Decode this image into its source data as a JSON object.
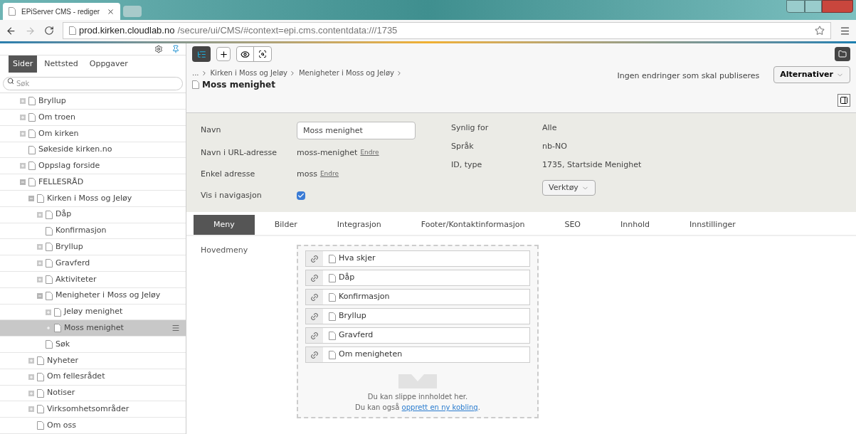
{
  "browser": {
    "tab_title": "EPiServer CMS - rediger",
    "url_host": "prod.kirken.cloudlab.no",
    "url_path": "/secure/ui/CMS/#context=epi.cms.contentdata:///1735"
  },
  "sidebar": {
    "tabs": [
      {
        "label": "Sider",
        "selected": true
      },
      {
        "label": "Nettsted",
        "selected": false
      },
      {
        "label": "Oppgaver",
        "selected": false
      }
    ],
    "search": {
      "placeholder": "Søk"
    },
    "tree": [
      {
        "label": "Bryllup",
        "expandable": true,
        "expanded": false,
        "selected": false
      },
      {
        "label": "Om troen",
        "expandable": true,
        "expanded": false,
        "selected": false
      },
      {
        "label": "Om kirken",
        "expandable": true,
        "expanded": false,
        "selected": false
      },
      {
        "label": "Søkeside kirken.no",
        "expandable": false,
        "expanded": false,
        "selected": false
      },
      {
        "label": "Oppslag forside",
        "expandable": true,
        "expanded": false,
        "selected": false
      },
      {
        "label": "FELLESRÅD",
        "expandable": true,
        "expanded": true,
        "selected": false,
        "children": [
          {
            "label": "Kirken i Moss og Jeløy",
            "expandable": true,
            "expanded": true,
            "selected": false,
            "children": [
              {
                "label": "Dåp",
                "expandable": true,
                "expanded": false,
                "selected": false
              },
              {
                "label": "Konfirmasjon",
                "expandable": false,
                "expanded": false,
                "selected": false
              },
              {
                "label": "Bryllup",
                "expandable": true,
                "expanded": false,
                "selected": false
              },
              {
                "label": "Gravferd",
                "expandable": true,
                "expanded": false,
                "selected": false
              },
              {
                "label": "Aktiviteter",
                "expandable": true,
                "expanded": false,
                "selected": false
              },
              {
                "label": "Menigheter i Moss og Jeløy",
                "expandable": true,
                "expanded": true,
                "selected": false,
                "children": [
                  {
                    "label": "Jeløy menighet",
                    "expandable": true,
                    "expanded": false,
                    "selected": false
                  },
                  {
                    "label": "Moss menighet",
                    "expandable": true,
                    "expanded": false,
                    "selected": true
                  }
                ]
              },
              {
                "label": "Søk",
                "expandable": false,
                "expanded": false,
                "selected": false
              }
            ]
          },
          {
            "label": "Nyheter",
            "expandable": true,
            "expanded": false,
            "selected": false
          },
          {
            "label": "Om fellesrådet",
            "expandable": true,
            "expanded": false,
            "selected": false
          },
          {
            "label": "Notiser",
            "expandable": true,
            "expanded": false,
            "selected": false
          },
          {
            "label": "Virksomhetsområder",
            "expandable": true,
            "expanded": false,
            "selected": false
          },
          {
            "label": "Om oss",
            "expandable": false,
            "expanded": false,
            "selected": false
          }
        ]
      }
    ]
  },
  "breadcrumb": [
    "...",
    "Kirken i Moss og Jeløy",
    "Menigheter i Moss og Jeløy"
  ],
  "page_title": "Moss menighet",
  "publish_status": "Ingen endringer som skal publiseres",
  "options_button": "Alternativer",
  "form_left": [
    {
      "kind": "input",
      "label": "Navn",
      "value": "Moss menighet"
    },
    {
      "kind": "link",
      "label": "Navn i URL-adresse",
      "value": "moss-menighet",
      "link": "Endre"
    },
    {
      "kind": "link",
      "label": "Enkel adresse",
      "value": "moss",
      "link": "Endre"
    },
    {
      "kind": "checkbox",
      "label": "Vis i navigasjon",
      "checked": true
    }
  ],
  "form_right": [
    {
      "label": "Synlig for",
      "value": "Alle"
    },
    {
      "label": "Språk",
      "value": "nb-NO"
    },
    {
      "label": "ID, type",
      "value": "1735, Startside Menighet"
    }
  ],
  "tools_button": "Verktøy",
  "content_tabs": [
    {
      "label": "Meny",
      "selected": true
    },
    {
      "label": "Bilder",
      "selected": false
    },
    {
      "label": "Integrasjon",
      "selected": false
    },
    {
      "label": "Footer/Kontaktinformasjon",
      "selected": false
    },
    {
      "label": "SEO",
      "selected": false
    },
    {
      "label": "Innhold",
      "selected": false
    },
    {
      "label": "Innstillinger",
      "selected": false
    }
  ],
  "main_menu": {
    "label": "Hovedmeny",
    "items": [
      "Hva skjer",
      "Dåp",
      "Konfirmasjon",
      "Bryllup",
      "Gravferd",
      "Om menigheten"
    ],
    "drop_line1": "Du kan slippe innholdet her.",
    "drop_prefix": "Du kan også",
    "drop_link": "opprett en ny kobling",
    "drop_suffix": "."
  }
}
